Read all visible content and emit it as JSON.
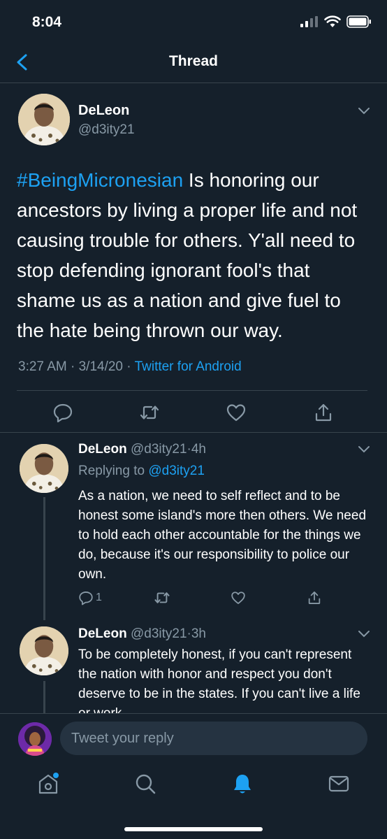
{
  "status_bar": {
    "time": "8:04"
  },
  "nav": {
    "title": "Thread"
  },
  "main_tweet": {
    "author_name": "DeLeon",
    "author_handle": "@d3ity21",
    "hashtag": "#BeingMicronesian",
    "body": " Is honoring our ancestors by living a proper life and not causing trouble for others. Y'all need to stop defending ignorant fool's that shame us as a nation and give fuel to the hate being thrown our way.",
    "time": "3:27 AM",
    "date": "3/14/20",
    "separator": " · ",
    "source": "Twitter for Android"
  },
  "replies": [
    {
      "author_name": "DeLeon",
      "author_handle": "@d3ity21",
      "age": "4h",
      "replying_prefix": "Replying to ",
      "replying_to": "@d3ity21",
      "text": "As a nation, we need to self reflect and to be honest some island's more then others. We need to hold each other accountable for the things we do, because it's our responsibility to police our own.",
      "reply_count": "1"
    },
    {
      "author_name": "DeLeon",
      "author_handle": "@d3ity21",
      "age": "3h",
      "text": "To be completely honest, if you can't represent the nation with honor and respect you don't deserve to be in the states. If you can't live a life or work"
    }
  ],
  "compose": {
    "placeholder": "Tweet your reply"
  },
  "colors": {
    "background": "#15202b",
    "accent": "#1da1f2",
    "muted": "#8899a6",
    "divider": "#38444d"
  }
}
